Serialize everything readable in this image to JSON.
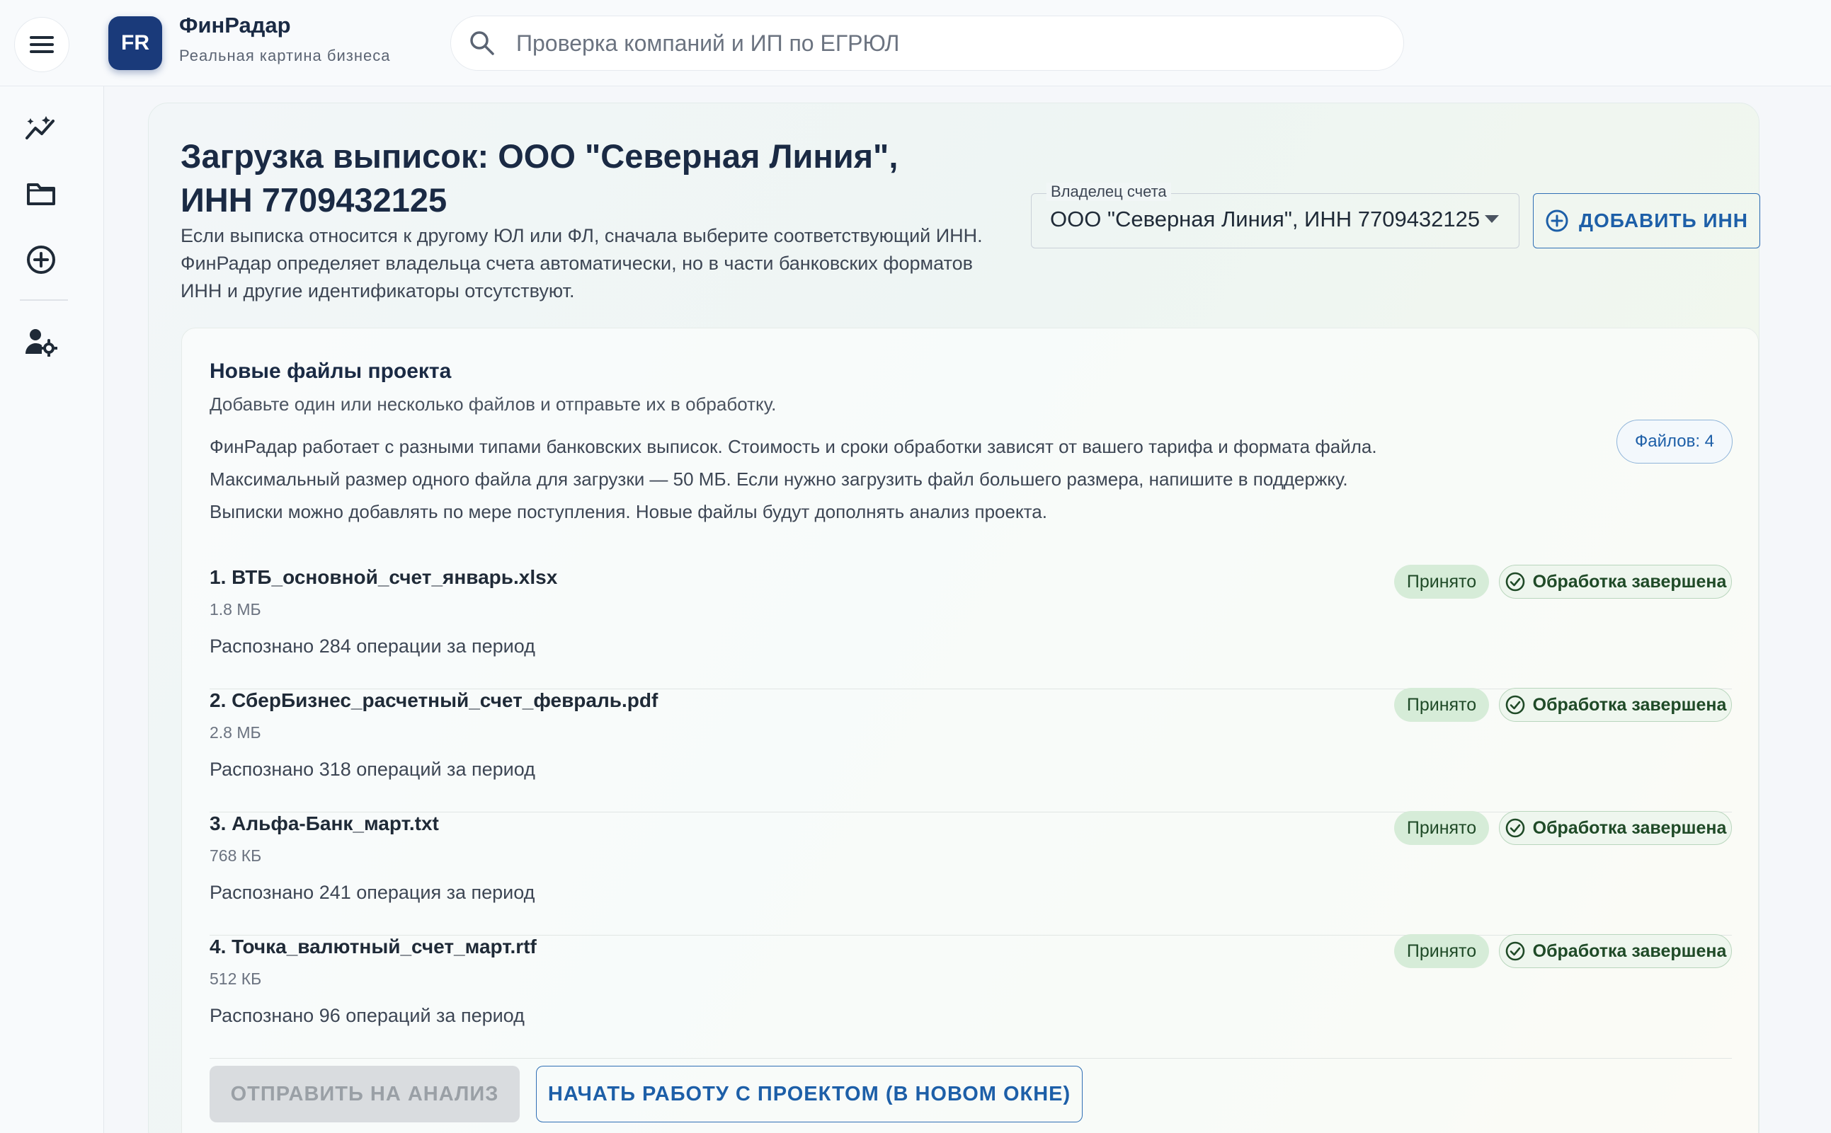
{
  "brand": {
    "logo_text": "FR",
    "name": "ФинРадар",
    "tagline": "Реальная картина бизнеса"
  },
  "search": {
    "placeholder": "Проверка компаний и ИП по ЕГРЮЛ",
    "value": ""
  },
  "sidebar": {
    "items": [
      {
        "icon": "analytics-icon"
      },
      {
        "icon": "folder-icon"
      },
      {
        "icon": "add-circle-icon"
      },
      {
        "icon": "user-settings-icon"
      }
    ]
  },
  "page": {
    "title": "Загрузка выписок: ООО \"Северная Линия\", ИНН 7709432125",
    "description": "Если выписка относится к другому ЮЛ или ФЛ, сначала выберите соответствующий ИНН. ФинРадар определяет владельца счета автоматически, но в части банковских форматов ИНН и другие идентификаторы отсутствуют."
  },
  "owner_select": {
    "label": "Владелец счета",
    "value": "ООО \"Северная Линия\", ИНН 7709432125"
  },
  "add_inn_button": {
    "label": "ДОБАВИТЬ ИНН"
  },
  "files_section": {
    "title": "Новые файлы проекта",
    "subtitle": "Добавьте один или несколько файлов и отправьте их в обработку.",
    "info_lines": [
      "ФинРадар работает с разными типами банковских выписок. Стоимость и сроки обработки зависят от вашего тарифа и формата файла.",
      "Максимальный размер одного файла для загрузки — 50 МБ. Если нужно загрузить файл большего размера, напишите в поддержку.",
      "Выписки можно добавлять по мере поступления. Новые файлы будут дополнять анализ проекта."
    ],
    "count_label": "Файлов: 4",
    "files": [
      {
        "name": "1. ВТБ_основной_счет_январь.xlsx",
        "size": "1.8 МБ",
        "ops": "Распознано 284 операции за период",
        "accepted": "Принято",
        "status": "Обработка завершена"
      },
      {
        "name": "2. СберБизнес_расчетный_счет_февраль.pdf",
        "size": "2.8 МБ",
        "ops": "Распознано 318 операций за период",
        "accepted": "Принято",
        "status": "Обработка завершена"
      },
      {
        "name": "3. Альфа-Банк_март.txt",
        "size": "768 КБ",
        "ops": "Распознано 241 операция за период",
        "accepted": "Принято",
        "status": "Обработка завершена"
      },
      {
        "name": "4. Точка_валютный_счет_март.rtf",
        "size": "512 КБ",
        "ops": "Распознано 96 операций за период",
        "accepted": "Принято",
        "status": "Обработка завершена"
      }
    ]
  },
  "actions": {
    "send_label": "ОТПРАВИТЬ НА АНАЛИЗ",
    "start_label": "НАЧАТЬ РАБОТУ С ПРОЕКТОМ (В НОВОМ ОКНЕ)"
  },
  "colors": {
    "brand": "#1a3a7a",
    "accent": "#1d5fa8",
    "success": "#1f4a27"
  }
}
